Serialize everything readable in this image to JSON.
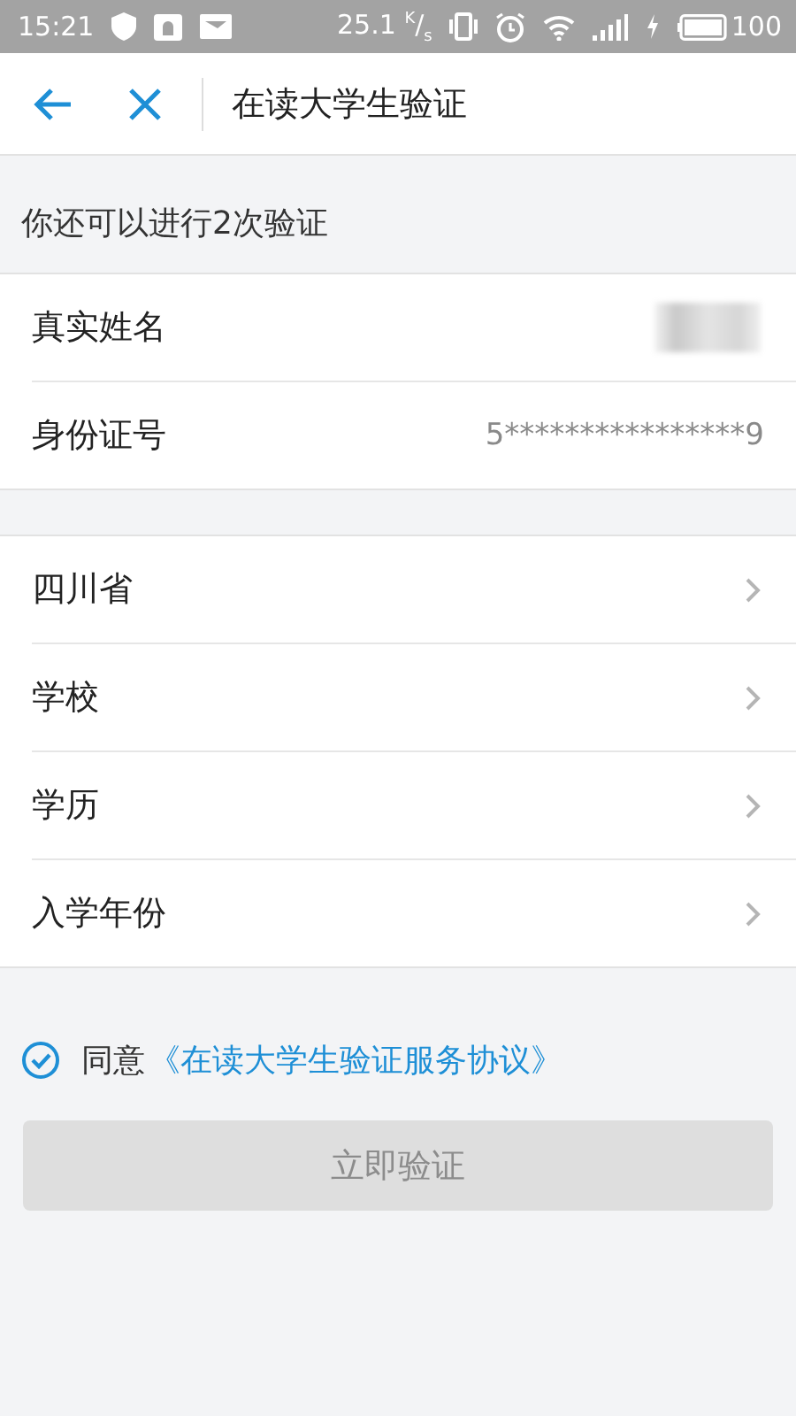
{
  "status_bar": {
    "time": "15:21",
    "speed": "25.1 $^{K}$/$_{s}$",
    "battery": "100"
  },
  "header": {
    "title": "在读大学生验证"
  },
  "notice": "你还可以进行2次验证",
  "identity_rows": [
    {
      "kind": "redacted",
      "label": "真实姓名"
    },
    {
      "kind": "value",
      "label": "身份证号",
      "value": "5****************9"
    }
  ],
  "selection_rows": [
    {
      "kind": "picker",
      "label": "四川省"
    },
    {
      "kind": "picker",
      "label": "学校"
    },
    {
      "kind": "picker",
      "label": "学历"
    },
    {
      "kind": "picker",
      "label": "入学年份"
    }
  ],
  "agreement": {
    "checked": true,
    "text": "同意",
    "link": "《在读大学生验证服务协议》"
  },
  "submit": {
    "label": "立即验证",
    "disabled": true
  }
}
